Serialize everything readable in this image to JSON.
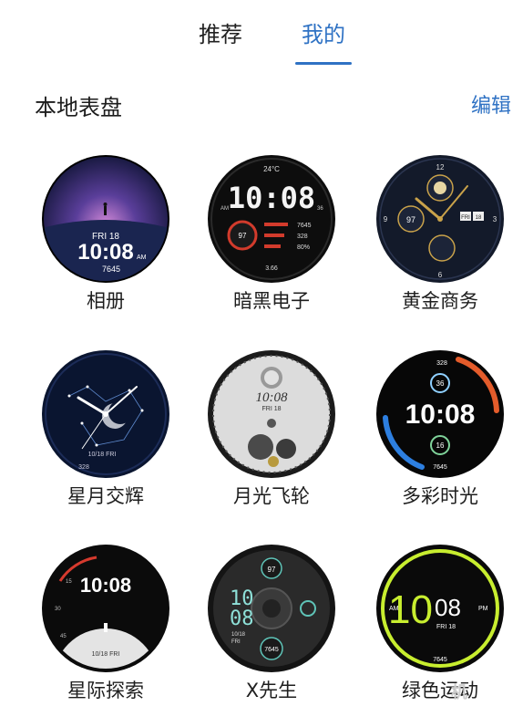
{
  "tabs": {
    "recommended": "推荐",
    "mine": "我的"
  },
  "section": {
    "title": "本地表盘",
    "edit": "编辑"
  },
  "faces": [
    {
      "name": "相册",
      "time": "10:08",
      "date": "FRI 18",
      "ampm": "AM",
      "steps": "7645"
    },
    {
      "name": "暗黑电子",
      "time": "10:08",
      "temp": "24°C",
      "heart": "97",
      "calories": "328",
      "battery": "80%",
      "steps": "7645",
      "distance": "3.66",
      "ampm": "AM",
      "sec": "36"
    },
    {
      "name": "黄金商务",
      "heart": "97",
      "date_day": "FRI",
      "date_num": "18",
      "n12": "12",
      "n3": "3",
      "n6": "6",
      "n9": "9"
    },
    {
      "name": "星月交辉",
      "date": "10/18 FRI",
      "steps": "328"
    },
    {
      "name": "月光飞轮",
      "time": "10:08",
      "date": "FRI 18"
    },
    {
      "name": "多彩时光",
      "time": "10:08",
      "top": "36",
      "bottom": "16",
      "steps": "7645",
      "calories": "328"
    },
    {
      "name": "星际探索",
      "time": "10:08",
      "date": "10/18 FRI",
      "m15": "15",
      "m30": "30",
      "m45": "45"
    },
    {
      "name": "X先生",
      "hour": "10",
      "minute": "08",
      "date": "10/18",
      "day": "FRI",
      "heart": "97",
      "steps": "7645"
    },
    {
      "name": "绿色运动",
      "hour": "10",
      "minute": "08",
      "date": "FRI 18",
      "am": "AM",
      "pm": "PM",
      "steps": "7645"
    }
  ],
  "watermark": "机"
}
